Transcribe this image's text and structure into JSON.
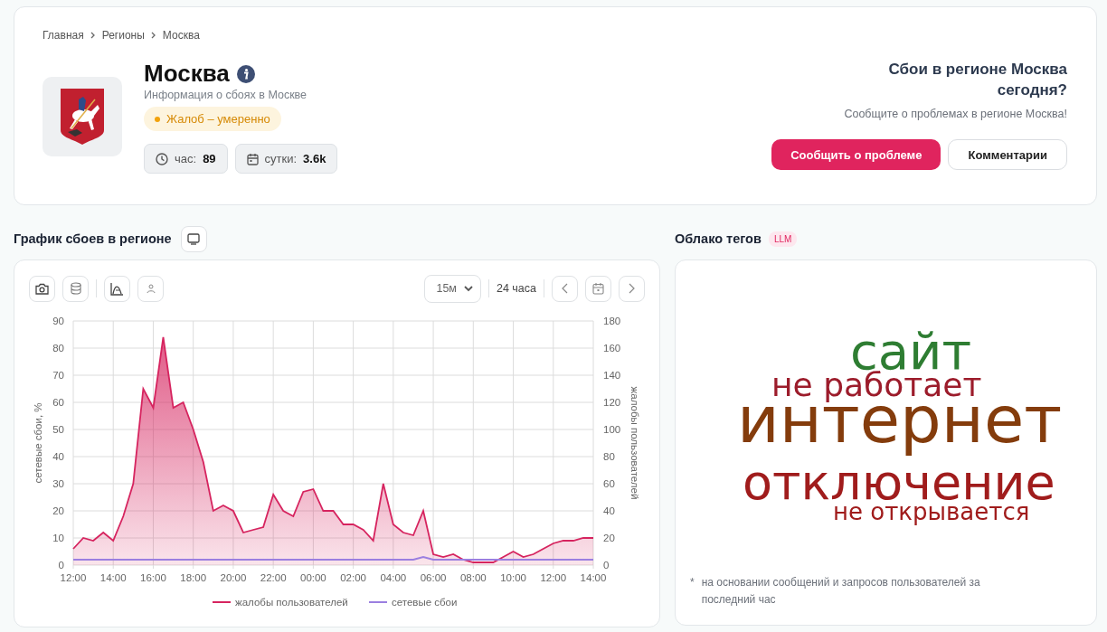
{
  "breadcrumbs": [
    {
      "label": "Главная"
    },
    {
      "label": "Регионы"
    },
    {
      "label": "Москва"
    }
  ],
  "region": {
    "title": "Москва",
    "subtitle": "Информация о сбоях в Москве",
    "status": "Жалоб – умеренно",
    "stats": [
      {
        "kind": "hour",
        "label": "час:",
        "value": "89"
      },
      {
        "kind": "day",
        "label": "сутки:",
        "value": "3.6k"
      }
    ]
  },
  "report": {
    "title": "Сбои в регионе Москва сегодня?",
    "text": "Сообщите о проблемах в регионе Москва!",
    "buttons": [
      {
        "kind": "primary",
        "label": "Сообщить о проблеме"
      },
      {
        "kind": "secondary",
        "label": "Комментарии"
      }
    ]
  },
  "chart_panel": {
    "title": "График сбоев в регионе",
    "interval": "15м",
    "period": "24 часа",
    "chart_data": {
      "type": "area",
      "ylabel": "сетевые сбои, %",
      "y2label": "жалобы пользователей",
      "categories": [
        "12:00",
        null,
        null,
        null,
        "14:00",
        null,
        null,
        null,
        "16:00",
        null,
        null,
        null,
        "18:00",
        null,
        null,
        null,
        "20:00",
        null,
        null,
        null,
        "22:00",
        null,
        null,
        null,
        "00:00",
        null,
        null,
        null,
        "02:00",
        null,
        null,
        null,
        "04:00",
        null,
        null,
        null,
        "06:00",
        null,
        null,
        null,
        "08:00",
        null,
        null,
        null,
        "10:00",
        null,
        null,
        null,
        "12:00",
        null,
        null,
        null,
        "14:00"
      ],
      "ylim": [
        0,
        90
      ],
      "y2lim": [
        0,
        180
      ],
      "grid": true,
      "legend": true,
      "yticks": [
        0,
        10,
        20,
        30,
        40,
        50,
        60,
        70,
        80,
        90
      ],
      "y2ticks": [
        0,
        20,
        40,
        60,
        80,
        100,
        120,
        140,
        160,
        180
      ],
      "series": [
        {
          "name": "жалобы пользователей",
          "color": "#d6245f",
          "axis": "y2",
          "values": [
            12,
            20,
            18,
            24,
            18,
            36,
            60,
            130,
            116,
            168,
            116,
            120,
            100,
            76,
            40,
            44,
            40,
            24,
            26,
            28,
            52,
            40,
            36,
            54,
            56,
            40,
            40,
            30,
            30,
            26,
            18,
            60,
            30,
            24,
            22,
            40,
            8,
            6,
            8,
            4,
            2,
            2,
            2,
            6,
            10,
            6,
            8,
            12,
            16,
            18,
            18,
            20,
            20
          ]
        },
        {
          "name": "сетевые сбои",
          "color": "#9b7fe0",
          "type": "line",
          "values": [
            2,
            2,
            2,
            2,
            2,
            2,
            2,
            2,
            2,
            2,
            2,
            2,
            2,
            2,
            2,
            2,
            2,
            2,
            2,
            2,
            2,
            2,
            2,
            2,
            2,
            2,
            2,
            2,
            2,
            2,
            2,
            2,
            2,
            2,
            2,
            3,
            2,
            2,
            2,
            2,
            2,
            2,
            2,
            2,
            2,
            2,
            2,
            2,
            2,
            2,
            2,
            2,
            2
          ]
        }
      ]
    }
  },
  "tag_cloud": {
    "title": "Облако тегов",
    "badge": "LLM",
    "tags": [
      {
        "text": "сайт",
        "color": "#2e7d32"
      },
      {
        "text": "не работает",
        "color": "#9c1c2b"
      },
      {
        "text": "интернет",
        "color": "#843c0c"
      },
      {
        "text": "отключение",
        "color": "#a01c1c"
      },
      {
        "text": "не открывается",
        "color": "#a01c1c"
      }
    ],
    "footnote_mark": "*",
    "footnote": "на основании сообщений и запросов пользователей за последний час"
  }
}
